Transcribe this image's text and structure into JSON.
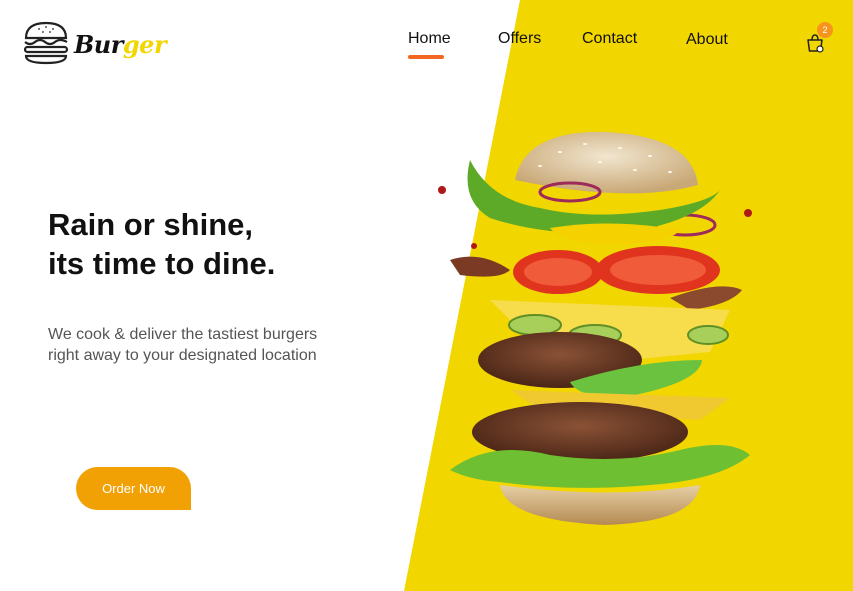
{
  "brand": {
    "name_part1": "Bur",
    "name_part2": "ger"
  },
  "nav": {
    "home": "Home",
    "offers": "Offers",
    "contact": "Contact",
    "about": "About"
  },
  "cart": {
    "count": "2",
    "icon": "cart-icon"
  },
  "hero": {
    "title_line1": "Rain or shine,",
    "title_line2": "its time to dine.",
    "subtitle_line1": "We cook & deliver the tastiest burgers",
    "subtitle_line2": "right away to your designated location",
    "cta": "Order Now"
  },
  "colors": {
    "accent_yellow": "#f2d600",
    "cta_orange": "#f2a105",
    "underline": "#f26722",
    "badge": "#f7941d"
  }
}
